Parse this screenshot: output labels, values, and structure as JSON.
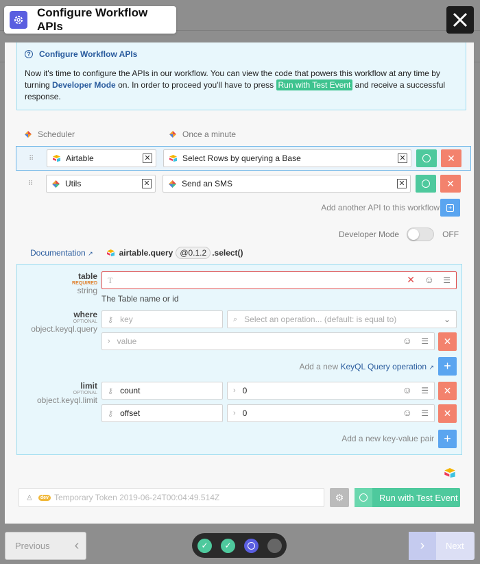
{
  "modal": {
    "title": "Configure Workflow APIs",
    "close_label": "✕"
  },
  "info": {
    "heading": "Configure Workflow APIs",
    "text1": "Now it's time to configure the APIs in our workflow. You can view the code that powers this workflow at any time by turning ",
    "dev_link": "Developer Mode",
    "text2": " on. In order to proceed you'll have to press ",
    "run_pill": "Run with Test Event",
    "text3": " and receive a successful response."
  },
  "trigger": {
    "service": "Scheduler",
    "schedule": "Once a minute"
  },
  "apis": [
    {
      "service": "Airtable",
      "method": "Select Rows by querying a Base"
    },
    {
      "service": "Utils",
      "method": "Send an SMS"
    }
  ],
  "add_api_label": "Add another API to this workflow",
  "developer_mode": {
    "label": "Developer Mode",
    "state": "OFF"
  },
  "doc": {
    "link": "Documentation",
    "fn_name": "airtable.query",
    "version": "@0.1.2",
    "fn_suffix": ".select()"
  },
  "params": {
    "table": {
      "name": "table",
      "required": "REQUIRED",
      "type": "string",
      "input_icon": "T",
      "hint": "The Table name or id"
    },
    "where": {
      "name": "where",
      "optional": "OPTIONAL",
      "type": "object.keyql.query",
      "key_placeholder": "key",
      "op_placeholder": "Select an operation... (default: is equal to)",
      "value_placeholder": "value",
      "add_text": "Add a new ",
      "add_link": "KeyQL Query operation"
    },
    "limit": {
      "name": "limit",
      "optional": "OPTIONAL",
      "type": "object.keyql.limit",
      "rows": [
        {
          "key": "count",
          "value": "0"
        },
        {
          "key": "offset",
          "value": "0"
        }
      ],
      "add_text": "Add a new key-value pair"
    }
  },
  "token": {
    "badge": "dev",
    "text": "Temporary Token 2019-06-24T00:04:49.514Z"
  },
  "run_button": "Run with Test Event",
  "nav": {
    "previous": "Previous",
    "next": "Next",
    "steps": [
      "done",
      "done",
      "current",
      "todo"
    ]
  }
}
